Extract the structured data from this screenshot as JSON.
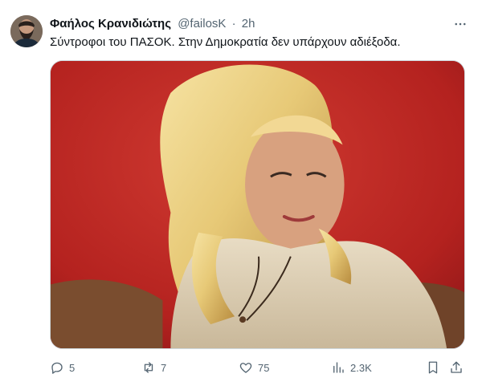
{
  "tweet": {
    "author_name": "Φαήλος Κρανιδιώτης",
    "handle": "@failosK",
    "separator": "·",
    "time": "2h",
    "text": "Σύντροφοι του ΠΑΣΟΚ. Στην Δημοκρατία δεν υπάρχουν αδιέξοδα.",
    "media_icon": "photo-of-woman-with-blond-hair"
  },
  "actions": {
    "reply_count": "5",
    "retweet_count": "7",
    "like_count": "75",
    "views_count": "2.3K"
  },
  "icons": {
    "more": "more-dots-icon",
    "reply": "reply-icon",
    "retweet": "retweet-icon",
    "like": "heart-icon",
    "views": "views-icon",
    "bookmark": "bookmark-icon",
    "share": "share-icon"
  },
  "colors": {
    "text": "#0f1419",
    "muted": "#536471",
    "border": "#cfd9de",
    "photo_background": "#b4221f"
  }
}
